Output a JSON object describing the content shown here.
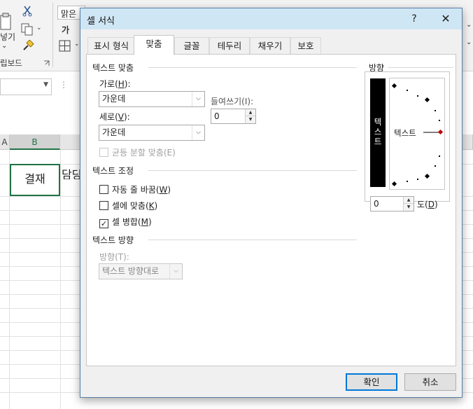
{
  "excel": {
    "ribbon": {
      "font_name": "맑은",
      "paste_label": "넣기",
      "clipboard_label": "립보드",
      "bold_label": "가"
    },
    "columns": [
      "A",
      "B"
    ],
    "cell_b2": "결재",
    "cell_c2": "담당"
  },
  "dialog": {
    "title": "셀 서식",
    "help_label": "?",
    "close_label": "✕",
    "tabs": [
      "표시 형식",
      "맞춤",
      "글꼴",
      "테두리",
      "채우기",
      "보호"
    ],
    "active_tab": "맞춤",
    "text_alignment": {
      "heading": "텍스트 맞춤",
      "horizontal": {
        "label": "가로(",
        "key": "H",
        "suffix": "):",
        "value": "가운데"
      },
      "indent": {
        "label": "들여쓰기(I):",
        "value": "0"
      },
      "vertical": {
        "label": "세로(",
        "key": "V",
        "suffix": "):",
        "value": "가운데"
      },
      "justify_distributed": {
        "label": "균등 분할 맞춤(E)",
        "checked": false
      }
    },
    "text_control": {
      "heading": "텍스트 조정",
      "wrap_text": {
        "label": "자동 줄 바꿈(",
        "key": "W",
        "suffix": ")",
        "checked": false
      },
      "shrink_to_fit": {
        "label": "셀에 맞춤(",
        "key": "K",
        "suffix": ")",
        "checked": false
      },
      "merge_cells": {
        "label": "셀 병합(",
        "key": "M",
        "suffix": ")",
        "checked": true
      }
    },
    "text_direction": {
      "heading": "텍스트 방향",
      "direction_label": "방향(T):",
      "direction_value": "텍스트 방향대로"
    },
    "orientation": {
      "heading": "방향",
      "vertical_text": "텍스트",
      "dial_text": "텍스트",
      "degrees_value": "0",
      "degrees_label": "도(",
      "degrees_key": "D",
      "degrees_suffix": ")"
    },
    "ok_label": "확인",
    "cancel_label": "취소",
    "colors": {
      "titlebar": "#cfe6f4",
      "accent": "#0078d7",
      "selection_green": "#217346",
      "indicator_red": "#c00000"
    }
  }
}
